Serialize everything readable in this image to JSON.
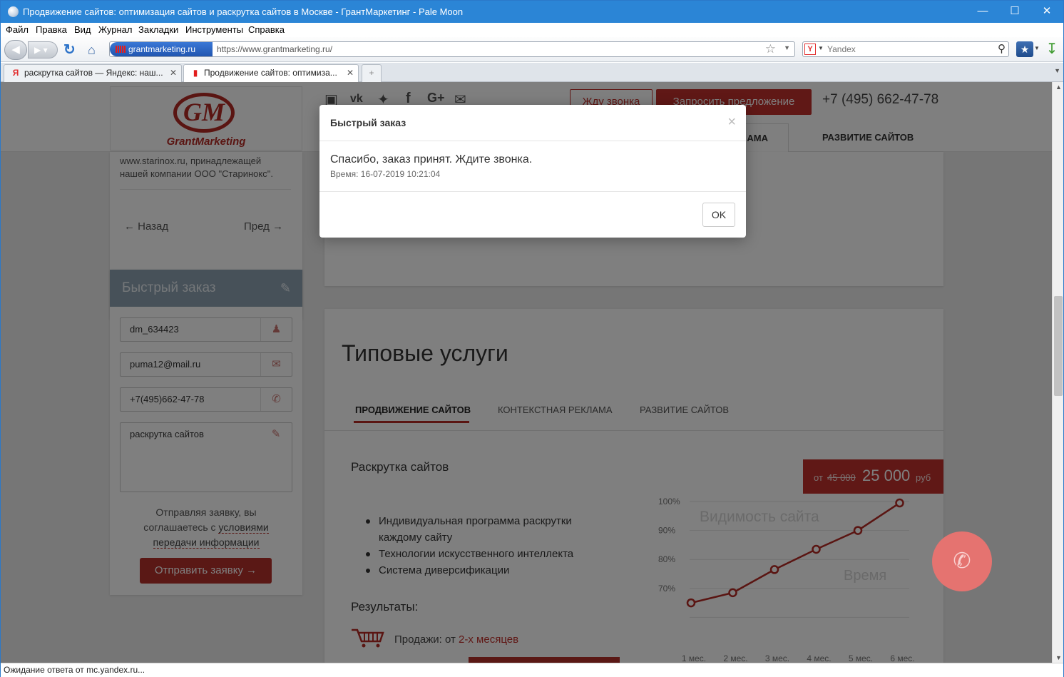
{
  "window": {
    "title": "Продвижение сайтов: оптимизация сайтов и раскрутка сайтов в Москве - ГрантМаркетинг - Pale Moon",
    "controls": {
      "minimize": "—",
      "maximize": "☐",
      "close": "✕"
    }
  },
  "menu": [
    "Файл",
    "Правка",
    "Вид",
    "Журнал",
    "Закладки",
    "Инструменты",
    "Справка"
  ],
  "navbar": {
    "site_identity": "grantmarketing.ru",
    "url": "https://www.grantmarketing.ru/",
    "search_engine_letter": "Y",
    "search_placeholder": "Yandex"
  },
  "tabs": [
    {
      "title": "раскрутка сайтов — Яндекс: наш...",
      "favicon": "Я",
      "close": "✕"
    },
    {
      "title": "Продвижение сайтов: оптимиза...",
      "favicon": "signal-bars",
      "close": "✕",
      "active": true
    }
  ],
  "header": {
    "logo_mark": "GM",
    "logo_text": "GrantMarketing",
    "callback_button": "Жду звонка",
    "offer_button": "Запросить предложение",
    "phone": "+7 (495) 662-47-78",
    "nav_partial": "АМА",
    "nav_dev": "РАЗВИТИЕ САЙТОВ"
  },
  "sidebar": {
    "info_text": "www.starinox.ru, принадлежащей нашей компании ООО \"Старинокс\".",
    "prev": "Назад",
    "next": "Пред",
    "order": {
      "title": "Быстрый заказ",
      "name": "dm_634423",
      "email": "puma12@mail.ru",
      "phone": "+7(495)662-47-78",
      "message": "раскрутка сайтов",
      "consent_prefix": "Отправляя заявку, вы соглашаетесь с ",
      "consent_link": "условиями передачи информации",
      "submit": "Отправить заявку"
    }
  },
  "services": {
    "title": "Типовые услуги",
    "tabs": [
      "ПРОДВИЖЕНИЕ САЙТОВ",
      "КОНТЕКСТНАЯ РЕКЛАМА",
      "РАЗВИТИЕ САЙТОВ"
    ],
    "service_name": "Раскрутка сайтов",
    "price_from": "от",
    "price_old": "45 000",
    "price_new": "25 000",
    "price_currency": "руб",
    "features": [
      "Индивидуальная программа раскрутки каждому сайту",
      "Технологии искусственного интеллекта",
      "Система диверсификации"
    ],
    "results_label": "Результаты:",
    "sales_prefix": "Продажи: от ",
    "sales_value": "2-х месяцев"
  },
  "chart_data": {
    "type": "line",
    "title": "Видимость сайта",
    "xlabel": "Время",
    "ylabel": "",
    "categories": [
      "1 мес.",
      "2 мес.",
      "3 мес.",
      "4 мес.",
      "5 мес.",
      "6 мес."
    ],
    "y_ticks": [
      "100%",
      "90%",
      "80%",
      "70%"
    ],
    "ylim": [
      65,
      100
    ],
    "series": [
      {
        "values": [
          65,
          68.5,
          76.5,
          83.5,
          90,
          99.5
        ]
      }
    ],
    "grid": true,
    "color": "#b52a25"
  },
  "modal": {
    "title": "Быстрый заказ",
    "close": "×",
    "message": "Спасибо, заказ принят. Ждите звонка.",
    "time": "Время: 16-07-2019 10:21:04",
    "ok": "OK"
  },
  "status": "Ожидание ответа от mc.yandex.ru..."
}
